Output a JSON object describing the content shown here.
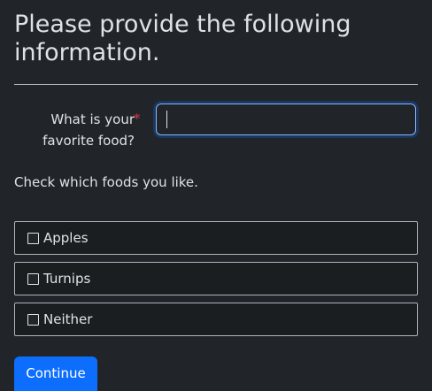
{
  "form": {
    "heading": "Please provide the following information.",
    "question": {
      "label": "What is your favorite food?",
      "required_marker": "*",
      "value": "",
      "placeholder": ""
    },
    "check_prompt": "Check which foods you like.",
    "options": [
      {
        "label": "Apples",
        "checked": false
      },
      {
        "label": "Turnips",
        "checked": false
      },
      {
        "label": "Neither",
        "checked": false
      }
    ],
    "continue_label": "Continue"
  },
  "colors": {
    "background": "#212529",
    "text": "#dee2e6",
    "accent": "#0d6efd",
    "required": "#dc3545",
    "focus_border": "#86b7fe"
  }
}
